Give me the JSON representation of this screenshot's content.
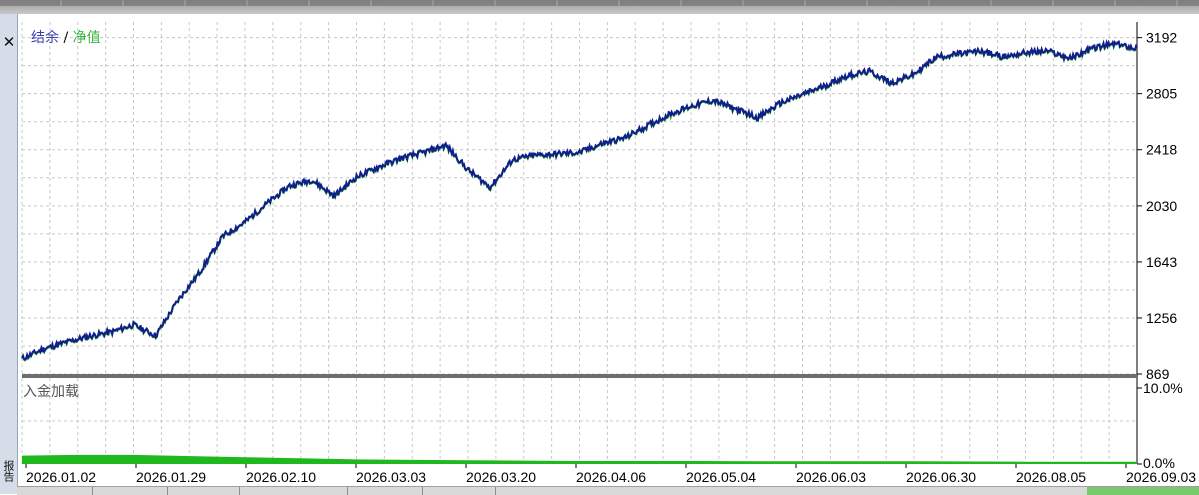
{
  "legend": {
    "balance": "结余",
    "separator": " / ",
    "equity": "净值"
  },
  "deposit_load_label": "入金加载",
  "side_tab_label": "报告",
  "colors": {
    "balance_line": "#0f1f8c",
    "equity_line": "#2e9a2e",
    "balance_text": "#3c3cb4",
    "equity_text": "#3cb43c",
    "deposit_bar": "#1fb81f",
    "grid": "#c8c8c8",
    "separator": "#6e6e6e"
  },
  "chart_data": [
    {
      "type": "line",
      "title": "",
      "series": [
        {
          "name": "结余",
          "x": [
            0,
            2,
            4,
            6,
            8,
            10,
            12,
            14,
            16,
            18,
            20,
            22,
            24,
            26,
            28,
            30,
            32,
            34,
            36,
            38,
            40,
            42,
            44,
            46,
            48,
            50,
            52,
            54,
            56,
            58,
            60,
            62,
            64,
            66,
            68,
            70,
            72,
            74,
            76,
            78,
            80,
            82,
            84,
            86,
            88,
            90,
            92,
            94,
            96,
            98,
            100
          ],
          "values": [
            975,
            1045,
            1090,
            1130,
            1160,
            1210,
            1135,
            1380,
            1580,
            1820,
            1920,
            2050,
            2170,
            2210,
            2100,
            2230,
            2300,
            2360,
            2400,
            2450,
            2280,
            2160,
            2350,
            2380,
            2390,
            2400,
            2460,
            2500,
            2580,
            2660,
            2720,
            2760,
            2700,
            2640,
            2740,
            2800,
            2860,
            2930,
            2960,
            2880,
            2940,
            3060,
            3080,
            3100,
            3060,
            3090,
            3100,
            3050,
            3120,
            3150,
            3120
          ]
        },
        {
          "name": "净值",
          "x": [
            0,
            2,
            4,
            6,
            8,
            10,
            12,
            14,
            16,
            18,
            20,
            22,
            24,
            26,
            28,
            30,
            32,
            34,
            36,
            38,
            40,
            42,
            44,
            46,
            48,
            50,
            52,
            54,
            56,
            58,
            60,
            62,
            64,
            66,
            68,
            70,
            72,
            74,
            76,
            78,
            80,
            82,
            84,
            86,
            88,
            90,
            92,
            94,
            96,
            98,
            100
          ],
          "values": [
            970,
            1040,
            1085,
            1125,
            1155,
            1205,
            1130,
            1375,
            1575,
            1815,
            1915,
            2045,
            2165,
            2205,
            2095,
            2225,
            2295,
            2355,
            2395,
            2445,
            2275,
            2155,
            2345,
            2375,
            2385,
            2395,
            2455,
            2495,
            2575,
            2655,
            2715,
            2755,
            2695,
            2635,
            2735,
            2795,
            2855,
            2925,
            2955,
            2875,
            2935,
            3055,
            3075,
            3095,
            3055,
            3085,
            3095,
            3045,
            3115,
            3145,
            3115
          ]
        }
      ],
      "yticks": [
        3192,
        2805,
        2418,
        2030,
        1643,
        1256,
        869
      ],
      "ylim": [
        869,
        3300
      ],
      "grid": true,
      "legend_position": "top-left"
    },
    {
      "type": "area",
      "title": "入金加载",
      "series": [
        {
          "name": "入金加载",
          "x": [
            0,
            5,
            10,
            20,
            30,
            40,
            50,
            60,
            70,
            80,
            90,
            100
          ],
          "values": [
            1.1,
            1.2,
            1.2,
            0.9,
            0.6,
            0.5,
            0.4,
            0.4,
            0.35,
            0.35,
            0.3,
            0.3
          ]
        }
      ],
      "yticks": [
        "10.0%",
        "0.0%"
      ],
      "ylim": [
        0,
        10
      ],
      "grid": true
    }
  ],
  "x_axis": {
    "tick_labels": [
      "2026.01.02",
      "2026.01.29",
      "2026.02.10",
      "2026.03.03",
      "2026.03.20",
      "2026.04.06",
      "2026.05.04",
      "2026.06.03",
      "2026.06.30",
      "2026.08.05",
      "2026.09.03"
    ]
  }
}
